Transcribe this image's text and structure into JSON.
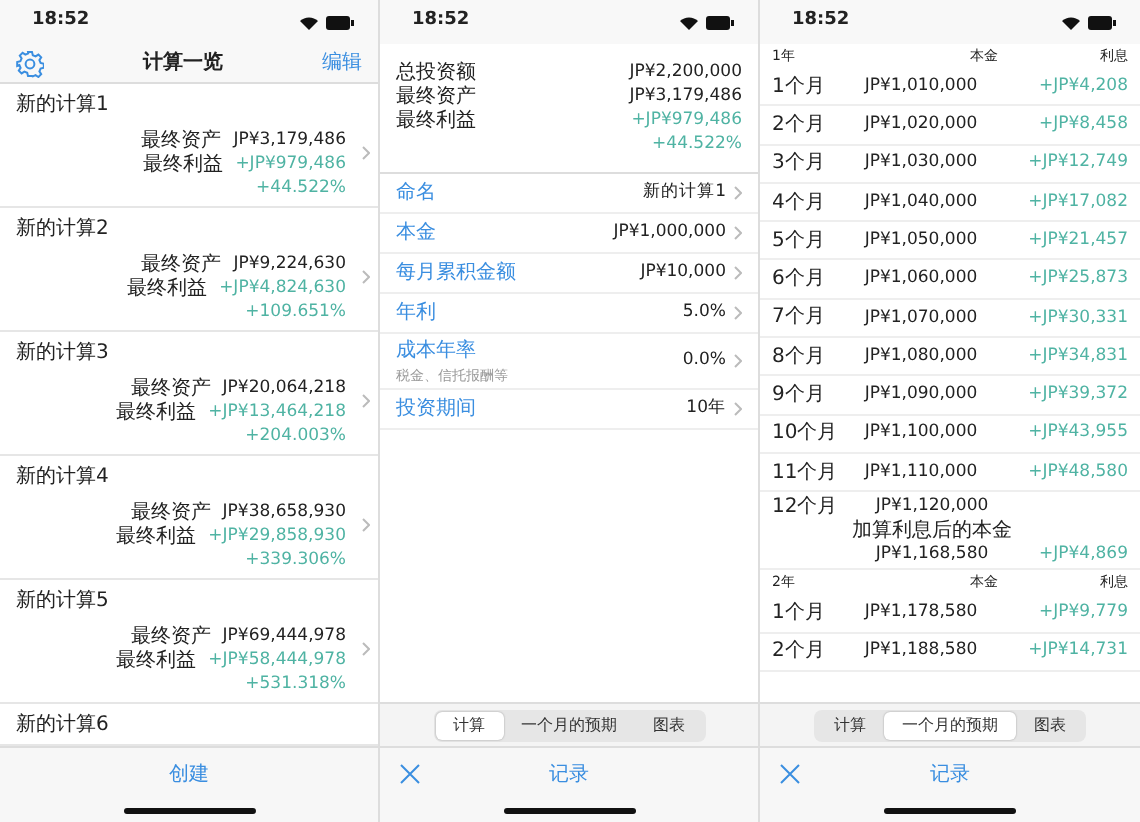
{
  "list_screen": {
    "status_time": "18:52",
    "title": "计算一览",
    "edit": "编辑",
    "items": [
      {
        "name": "新的计算1",
        "asset_label": "最终资产",
        "asset": "JP¥3,179,486",
        "profit_label": "最终利益",
        "profit": "+JP¥979,486",
        "rate": "+44.522%"
      },
      {
        "name": "新的计算2",
        "asset_label": "最终资产",
        "asset": "JP¥9,224,630",
        "profit_label": "最终利益",
        "profit": "+JP¥4,824,630",
        "rate": "+109.651%"
      },
      {
        "name": "新的计算3",
        "asset_label": "最终资产",
        "asset": "JP¥20,064,218",
        "profit_label": "最终利益",
        "profit": "+JP¥13,464,218",
        "rate": "+204.003%"
      },
      {
        "name": "新的计算4",
        "asset_label": "最终资产",
        "asset": "JP¥38,658,930",
        "profit_label": "最终利益",
        "profit": "+JP¥29,858,930",
        "rate": "+339.306%"
      },
      {
        "name": "新的计算5",
        "asset_label": "最终资产",
        "asset": "JP¥69,444,978",
        "profit_label": "最终利益",
        "profit": "+JP¥58,444,978",
        "rate": "+531.318%"
      },
      {
        "name": "新的计算6"
      }
    ],
    "create": "创建"
  },
  "detail_screen": {
    "status_time": "18:52",
    "summary": [
      {
        "label": "总投资额",
        "value": "JP¥2,200,000",
        "kind": "amount"
      },
      {
        "label": "最终资产",
        "value": "JP¥3,179,486",
        "kind": "amount"
      },
      {
        "label": "最终利益",
        "value": "+JP¥979,486",
        "kind": "gain"
      },
      {
        "value": "+44.522%",
        "kind": "gain"
      }
    ],
    "settings": [
      {
        "label": "命名",
        "value": "新的计算1"
      },
      {
        "label": "本金",
        "value": "JP¥1,000,000"
      },
      {
        "label": "每月累积金额",
        "value": "JP¥10,000"
      },
      {
        "label": "年利",
        "value": "5.0%"
      },
      {
        "label": "成本年率",
        "sublabel": "税金、信托报酬等",
        "value": "0.0%"
      },
      {
        "label": "投资期间",
        "value": "10年"
      }
    ],
    "segments": [
      {
        "label": "计算",
        "selected": true
      },
      {
        "label": "一个月的预期",
        "selected": false
      },
      {
        "label": "图表",
        "selected": false
      }
    ],
    "record": "记录"
  },
  "schedule_screen": {
    "status_time": "18:52",
    "years": [
      {
        "year": "1年",
        "principal_heading": "本金",
        "interest_heading": "利息",
        "months": [
          {
            "month": "1个月",
            "principal": "JP¥1,010,000",
            "interest": "+JP¥4,208"
          },
          {
            "month": "2个月",
            "principal": "JP¥1,020,000",
            "interest": "+JP¥8,458"
          },
          {
            "month": "3个月",
            "principal": "JP¥1,030,000",
            "interest": "+JP¥12,749"
          },
          {
            "month": "4个月",
            "principal": "JP¥1,040,000",
            "interest": "+JP¥17,082"
          },
          {
            "month": "5个月",
            "principal": "JP¥1,050,000",
            "interest": "+JP¥21,457"
          },
          {
            "month": "6个月",
            "principal": "JP¥1,060,000",
            "interest": "+JP¥25,873"
          },
          {
            "month": "7个月",
            "principal": "JP¥1,070,000",
            "interest": "+JP¥30,331"
          },
          {
            "month": "8个月",
            "principal": "JP¥1,080,000",
            "interest": "+JP¥34,831"
          },
          {
            "month": "9个月",
            "principal": "JP¥1,090,000",
            "interest": "+JP¥39,372"
          },
          {
            "month": "10个月",
            "principal": "JP¥1,100,000",
            "interest": "+JP¥43,955"
          },
          {
            "month": "11个月",
            "principal": "JP¥1,110,000",
            "interest": "+JP¥48,580"
          },
          {
            "month": "12个月",
            "principal": "JP¥1,120,000",
            "note": "加算利息后的本金",
            "total": "JP¥1,168,580",
            "interest": "+JP¥4,869"
          }
        ]
      },
      {
        "year": "2年",
        "principal_heading": "本金",
        "interest_heading": "利息",
        "months": [
          {
            "month": "1个月",
            "principal": "JP¥1,178,580",
            "interest": "+JP¥9,779"
          },
          {
            "month": "2个月",
            "principal": "JP¥1,188,580",
            "interest": "+JP¥14,731"
          }
        ]
      }
    ],
    "segments": [
      {
        "label": "计算",
        "selected": false
      },
      {
        "label": "一个月的预期",
        "selected": true
      },
      {
        "label": "图表",
        "selected": false
      }
    ],
    "record": "记录"
  }
}
